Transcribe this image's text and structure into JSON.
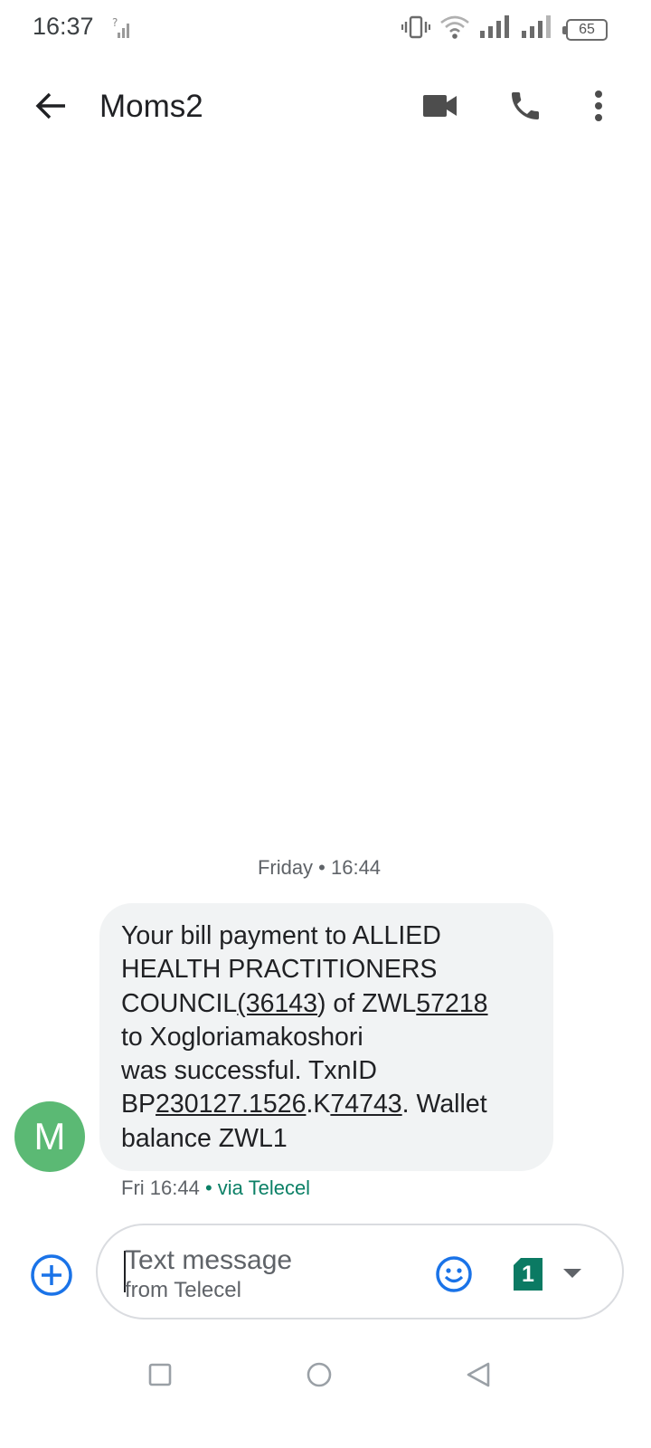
{
  "status_bar": {
    "time": "16:37",
    "battery_level": "65",
    "icons": [
      "no-sim-signal-icon",
      "vibrate-icon",
      "wifi-icon",
      "signal-icon",
      "signal-icon",
      "battery-icon"
    ]
  },
  "app_bar": {
    "title": "Moms2",
    "back_icon": "arrow-back-icon",
    "video_icon": "video-call-icon",
    "call_icon": "phone-icon",
    "more_icon": "more-vert-icon"
  },
  "messages": {
    "date_divider": "Friday • 16:44",
    "avatar_initial": "M",
    "avatar_color": "#5bb974",
    "items": [
      {
        "text": "Your bill payment to ALLIED HEALTH PRACTITIONERS COUNCIL(36143) of ZWL57218 to Xogloriamakoshori was successful. TxnID BP230127.1526.K74743. Wallet balance ZWL1",
        "line_1_text": "Your bill payment to ALLIED",
        "line_2_text": "HEALTH PRACTITIONERS",
        "line_3_prefix": "COUNCIL",
        "line_3_link_1": "(36143",
        "line_3_middle": ") of ZWL",
        "line_3_link_2": "57218",
        "line_4_text": "to Xogloriamakoshori",
        "line_5_text": "was successful. TxnID",
        "line_6_prefix": "BP",
        "line_6_link_1": "230127.1526",
        "line_6_middle": ".K",
        "line_6_link_2": "74743",
        "line_6_suffix": ". Wallet",
        "line_7_text": "balance ZWL1",
        "time": "Fri 16:44",
        "via": " • via Telecel"
      }
    ]
  },
  "compose": {
    "placeholder": "Text message",
    "subtext": "from Telecel",
    "sim_number": "1",
    "attach_icon": "add-circle-icon",
    "emoji_icon": "emoji-icon",
    "dropdown_icon": "arrow-drop-down-icon",
    "accent_color": "#1a73e8",
    "sim_color": "#0b7a63"
  },
  "nav_bar": {
    "recent_icon": "recent-apps-icon",
    "home_icon": "home-icon",
    "back_icon": "back-triangle-icon"
  }
}
